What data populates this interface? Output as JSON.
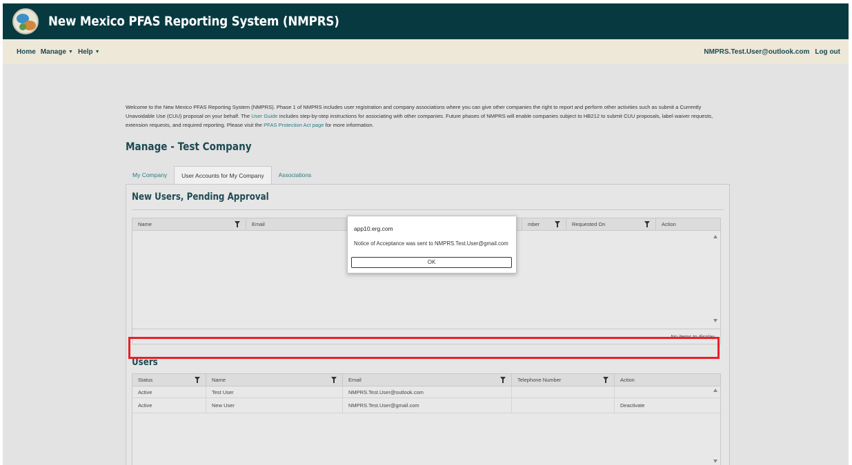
{
  "header": {
    "title": "New Mexico PFAS Reporting System (NMPRS)",
    "logo_icon": "state-seal-icon"
  },
  "nav": {
    "items": [
      {
        "label": "Home",
        "has_caret": false
      },
      {
        "label": "Manage",
        "has_caret": true
      },
      {
        "label": "Help",
        "has_caret": true
      }
    ],
    "user_email": "NMPRS.Test.User@outlook.com",
    "logout": "Log out"
  },
  "welcome": {
    "part1": "Welcome to the New Mexico PFAS Reporting System (NMPRS). Phase 1 of NMPRS includes user registration and company associations where you can give other companies the right to report and perform other activities such as submit a Currently Unavoidable Use (CUU) proposal on your behalf. The ",
    "link1": "User Guide",
    "part2": " includes step-by-step instructions for associating with other companies. Future phases of NMPRS will enable companies subject to HB212 to submit CUU proposals, label waiver requests, extension requests, and required reporting. Please visit the ",
    "link2": "PFAS Protection Act page",
    "part3": " for more information."
  },
  "page_title": "Manage - Test Company",
  "tabs": [
    {
      "label": "My Company",
      "active": false
    },
    {
      "label": "User Accounts for My Company",
      "active": true
    },
    {
      "label": "Associations",
      "active": false
    }
  ],
  "pending": {
    "title": "New Users, Pending Approval",
    "columns": [
      "Name",
      "Email",
      "mber",
      "Requested On",
      "Action"
    ],
    "empty_text": "No items to display"
  },
  "users": {
    "title": "Users",
    "columns": [
      "Status",
      "Name",
      "Email",
      "Telephone Number",
      "Action"
    ],
    "rows": [
      {
        "status": "Active",
        "name": "Test User",
        "email": "NMPRS.Test.User@outlook.com",
        "phone": "",
        "action": ""
      },
      {
        "status": "Active",
        "name": "New User",
        "email": "NMPRS.Test.User@gmail.com",
        "phone": "",
        "action": "Deactivate"
      }
    ]
  },
  "dialog": {
    "title": "app10.erg.com",
    "message": "Notice of Acceptance was sent to NMPRS.Test.User@gmail.com",
    "ok_label": "OK"
  },
  "colors": {
    "header_bg": "#063a40",
    "nav_bg": "#eee8d9",
    "highlight": "#e8202a",
    "link": "#2a7b83"
  }
}
